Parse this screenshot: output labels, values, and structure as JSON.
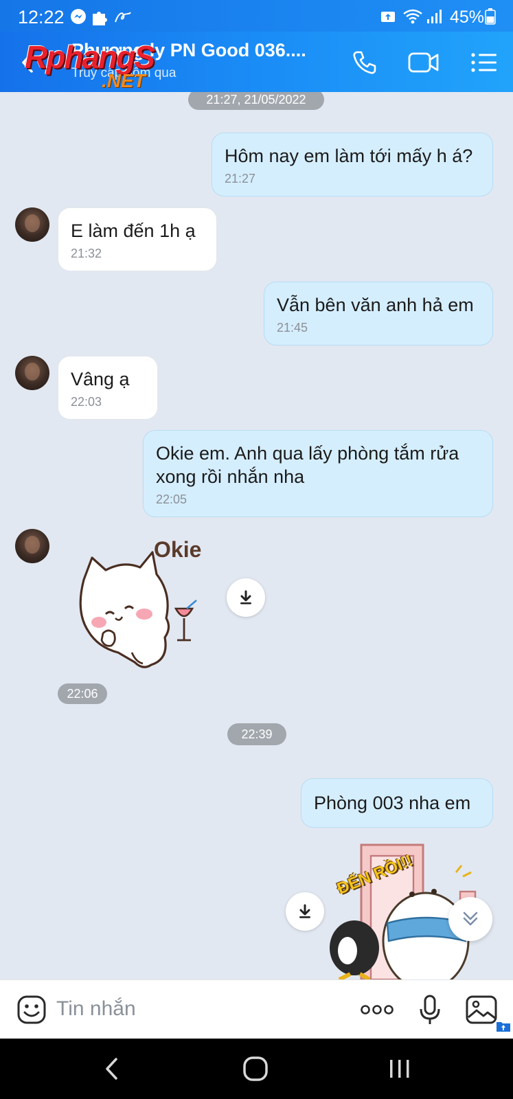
{
  "status_bar": {
    "time": "12:22",
    "battery": "45%",
    "icons": [
      "messenger-icon",
      "puzzle-icon",
      "signature-icon",
      "upload-icon",
      "wifi-icon",
      "signal-icon",
      "battery-icon"
    ]
  },
  "header": {
    "contact_name": "Phương ly PN Good 036....",
    "status": "Truy cập hôm qua",
    "watermark": {
      "main": "Rphang",
      "accent": "S",
      "sub": ".NET"
    },
    "colors": {
      "start": "#1571ea",
      "end": "#21a3fb"
    }
  },
  "chat": {
    "date_separator": "21:27, 21/05/2022",
    "messages": [
      {
        "dir": "out",
        "text": "Hôm nay em làm tới mấy h á?",
        "time": "21:27"
      },
      {
        "dir": "in",
        "text": "E làm đến 1h ạ",
        "time": "21:32"
      },
      {
        "dir": "out",
        "text": "Vẫn bên văn anh hả em",
        "time": "21:45"
      },
      {
        "dir": "in",
        "text": "Vâng ạ",
        "time": "22:03"
      },
      {
        "dir": "out",
        "text": "Okie em. Anh qua lấy phòng tắm rửa xong rồi nhắn nha",
        "time": "22:05"
      },
      {
        "dir": "out",
        "text": "Phòng 003 nha em"
      }
    ],
    "sticker_in": {
      "caption": "Okie",
      "time": "22:06"
    },
    "time_separator": "22:39",
    "sticker_out": {
      "caption": "ĐẾN RỒI!!"
    }
  },
  "input_bar": {
    "placeholder": "Tin nhắn"
  },
  "colors": {
    "chat_bg": "#e2e8f1",
    "bubble_out": "#d5eefe",
    "bubble_in": "#ffffff",
    "pill": "#a2a7ae"
  }
}
